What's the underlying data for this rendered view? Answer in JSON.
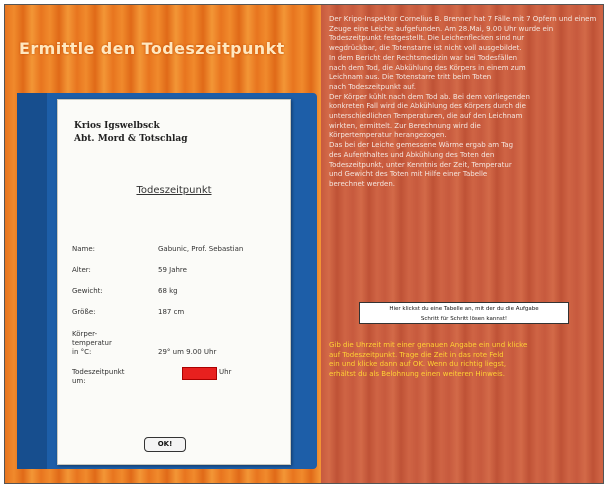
{
  "title": "Ermittle den Todeszeitpunkt",
  "document": {
    "header_line1": "Krios Igswelbsck",
    "header_line2": "Abt. Mord & Totschlag",
    "doc_title": "Todeszeitpunkt",
    "fields": [
      {
        "label": "Name:",
        "value": "Gabunic, Prof. Sebastian"
      },
      {
        "label": "Alter:",
        "value": "59 Jahre"
      },
      {
        "label": "Gewicht:",
        "value": "68 kg"
      },
      {
        "label": "Größe:",
        "value": "187 cm"
      },
      {
        "label": "Körper-\ntemperatur\nin °C:",
        "value": "29° um 9.00 Uhr"
      },
      {
        "label": "Todeszeitpunkt\num:",
        "value": ""
      }
    ],
    "time_unit": "Uhr",
    "ok_label": "OK!"
  },
  "instructions": {
    "paragraph": "Der Kripo-Inspektor Cornelius B. Brenner hat 7 Fälle mit 7 Opfern und einem\nZeuge eine Leiche aufgefunden. Am 28.Mai, 9.00 Uhr wurde ein\nTodeszeitpunkt festgestellt. Die Leichenflecken sind nur\nwegdrückbar, die Totenstarre ist nicht voll ausgebildet.\nIn dem Bericht der Rechtsmedizin war bei Todesfällen\nnach dem Tod, die Abkühlung des Körpers in einem zum\nLeichnam aus. Die Totenstarre tritt beim Toten\nnach Todeszeitpunkt auf.\nDer Körper kühlt nach dem Tod ab. Bei dem vorliegenden\nkonkreten Fall wird die Abkühlung des Körpers durch die\nunterschiedlichen Temperaturen, die auf den Leichnam\nwirkten, ermittelt. Zur Berechnung wird die\nKörpertemperatur herangezogen.\nDas bei der Leiche gemessene Wärme ergab am Tag\ndes Aufenthaltes und Abkühlung des Toten den\nTodeszeitpunkt, unter Kenntnis der Zeit, Temperatur\nund Gewicht des Toten mit Hilfe einer Tabelle\nberechnet werden.",
    "link_text": "Hier klickst du eine Tabelle an, mit der du die Aufgabe\nSchritt für Schritt lösen kannst!",
    "hint": "Gib die Uhrzeit mit einer genauen Angabe ein und klicke\nauf Todeszeitpunkt. Trage die Zeit in das rote Feld\nein und klicke dann auf OK. Wenn du richtig liegst,\nerhältst du als Belohnung einen weiteren Hinweis."
  }
}
